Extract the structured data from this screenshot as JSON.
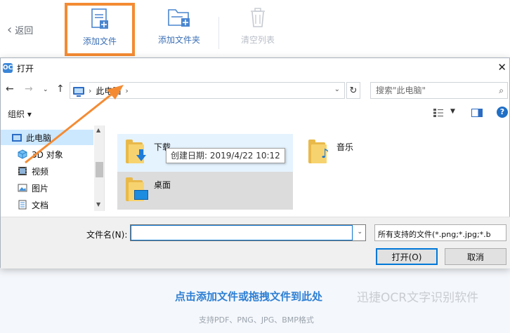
{
  "app": {
    "back_label": "返回",
    "toolbar": {
      "add_file": "添加文件",
      "add_folder": "添加文件夹",
      "clear_list": "清空列表"
    },
    "drop_hint": "点击添加文件或拖拽文件到此处",
    "watermark": "迅捷OCR文字识别软件",
    "formats_hint": "支持PDF、PNG、JPG、BMP格式",
    "highlight_color": "#f48b33",
    "accent_color": "#2d7fd4"
  },
  "dialog": {
    "title": "打开",
    "close_icon": "close-icon",
    "address": {
      "location": "此电脑"
    },
    "search_placeholder": "搜索\"此电脑\"",
    "organize_label": "组织",
    "nav_items": [
      {
        "label": "此电脑",
        "icon": "computer-icon",
        "selected": true
      },
      {
        "label": "3D 对象",
        "icon": "cube-icon"
      },
      {
        "label": "视频",
        "icon": "video-icon"
      },
      {
        "label": "图片",
        "icon": "picture-icon"
      },
      {
        "label": "文档",
        "icon": "document-icon"
      }
    ],
    "files": [
      {
        "name": "下载",
        "icon": "downloads-folder-icon"
      },
      {
        "name": "音乐",
        "icon": "music-folder-icon"
      },
      {
        "name": "桌面",
        "icon": "desktop-folder-icon"
      }
    ],
    "tooltip": "创建日期: 2019/4/22 10:12",
    "filename_label": "文件名(N):",
    "filename_value": "",
    "filetype_selected": "所有支持的文件(*.png;*.jpg;*.b",
    "open_button": "打开(O)",
    "cancel_button": "取消"
  }
}
